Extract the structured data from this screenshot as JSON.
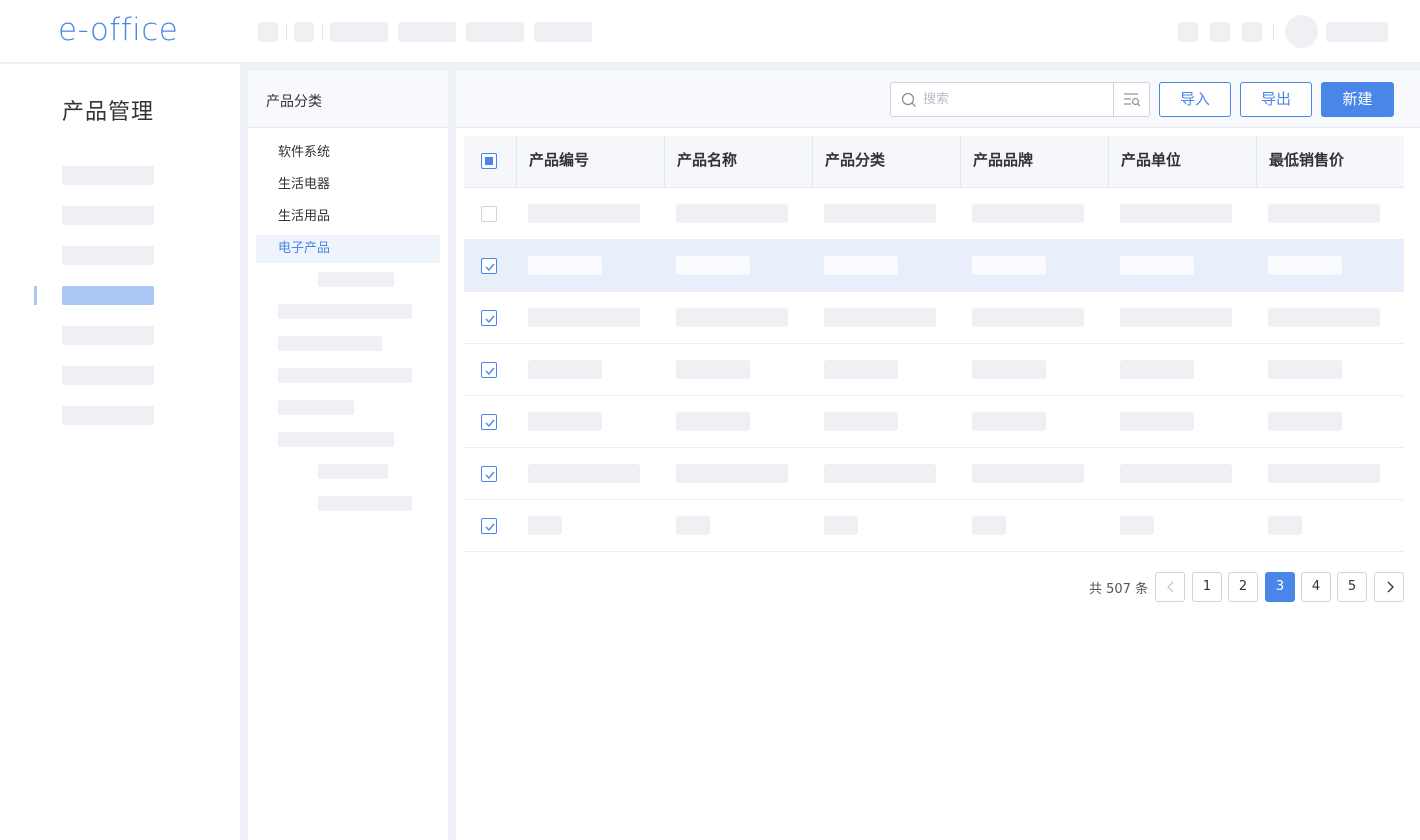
{
  "app": {
    "logo_text": "e-office"
  },
  "sidebar": {
    "title": "产品管理"
  },
  "categories": {
    "header": "产品分类",
    "items": [
      {
        "label": "软件系统"
      },
      {
        "label": "生活电器"
      },
      {
        "label": "生活用品"
      },
      {
        "label": "电子产品",
        "active": true
      }
    ]
  },
  "toolbar": {
    "search_placeholder": "搜索",
    "import_label": "导入",
    "export_label": "导出",
    "new_label": "新建"
  },
  "table": {
    "columns": [
      "产品编号",
      "产品名称",
      "产品分类",
      "产品品牌",
      "产品单位",
      "最低销售价"
    ],
    "rows": [
      {
        "checked": false,
        "selected": false
      },
      {
        "checked": true,
        "selected": true
      },
      {
        "checked": true,
        "selected": false
      },
      {
        "checked": true,
        "selected": false
      },
      {
        "checked": true,
        "selected": false
      },
      {
        "checked": true,
        "selected": false
      },
      {
        "checked": true,
        "selected": false
      }
    ]
  },
  "pagination": {
    "total_text": "共 507 条",
    "pages": [
      "1",
      "2",
      "3",
      "4",
      "5"
    ],
    "current_page": "3"
  },
  "colors": {
    "accent": "#4a86e8",
    "placeholder": "#eef0f4",
    "selected_row": "#e8eefa"
  },
  "icons": [
    "search-icon",
    "advanced-search-icon",
    "check-icon",
    "chevron-left-icon",
    "chevron-right-icon"
  ]
}
